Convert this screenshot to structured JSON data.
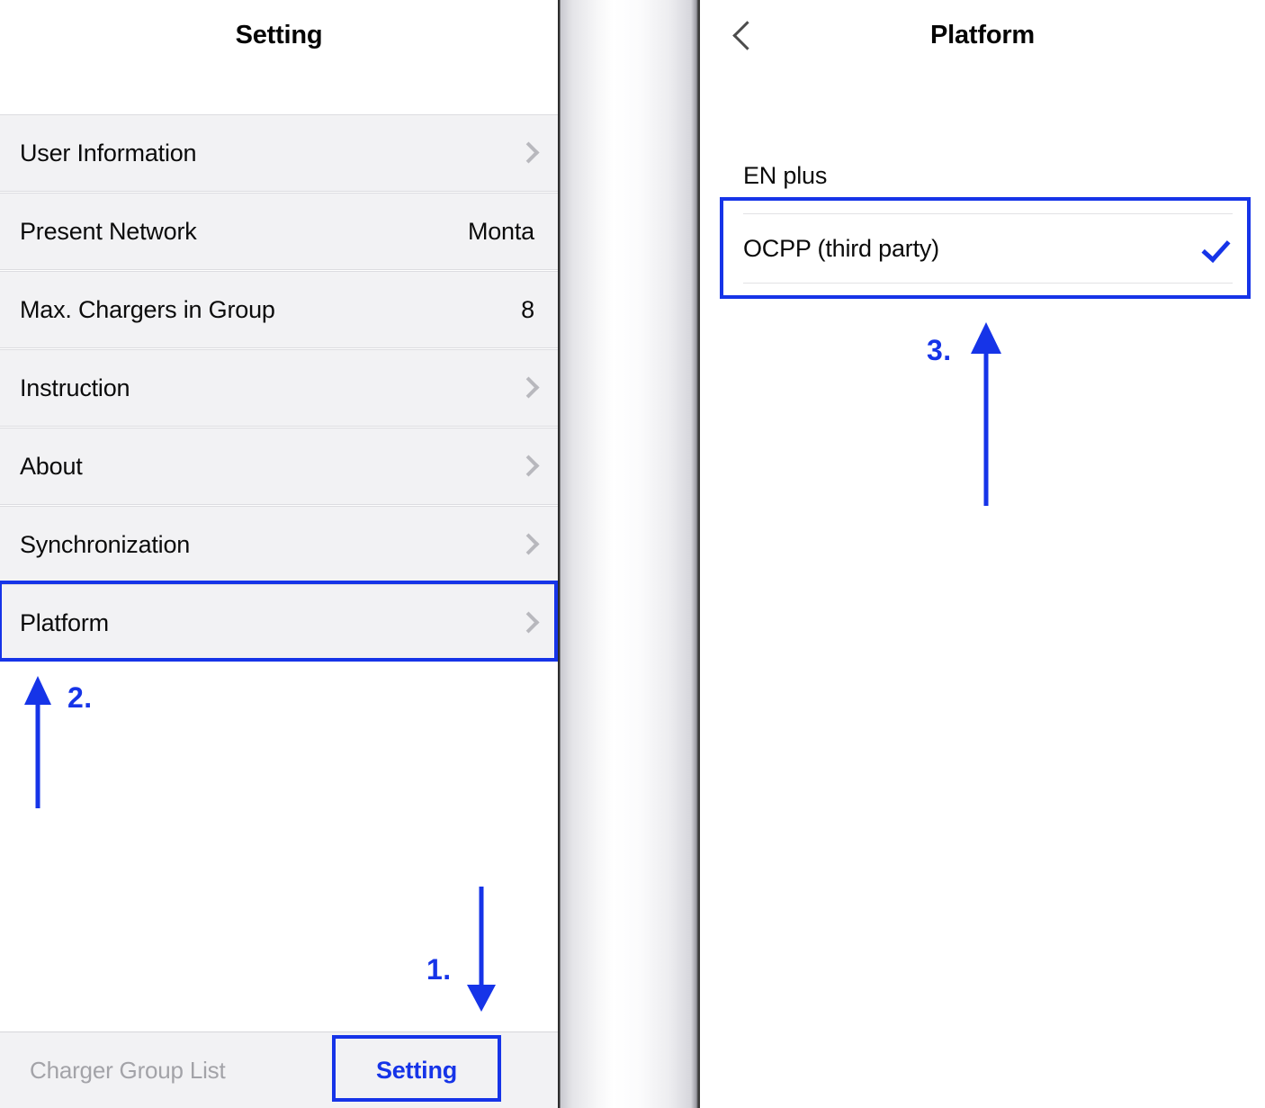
{
  "left_screen": {
    "nav_title": "Setting",
    "rows": [
      {
        "label": "User Information",
        "value": "",
        "accessory": "chevron"
      },
      {
        "label": "Present Network",
        "value": "Monta",
        "accessory": "value"
      },
      {
        "label": "Max. Chargers in Group",
        "value": "8",
        "accessory": "value"
      },
      {
        "label": "Instruction",
        "value": "",
        "accessory": "chevron"
      },
      {
        "label": "About",
        "value": "",
        "accessory": "chevron"
      },
      {
        "label": "Synchronization",
        "value": "",
        "accessory": "chevron"
      },
      {
        "label": "Platform",
        "value": "",
        "accessory": "chevron"
      }
    ],
    "tabbar": {
      "inactive_tab": "Charger Group List",
      "active_tab": "Setting"
    }
  },
  "right_screen": {
    "nav_title": "Platform",
    "back_icon": "chevron-left-icon",
    "section_header": "EN plus",
    "option": {
      "label": "OCPP (third party)",
      "selected_icon": "check-icon",
      "selected": true
    }
  },
  "annotations": {
    "step1": "1.",
    "step2": "2.",
    "step3": "3.",
    "color": "#1634e8"
  }
}
